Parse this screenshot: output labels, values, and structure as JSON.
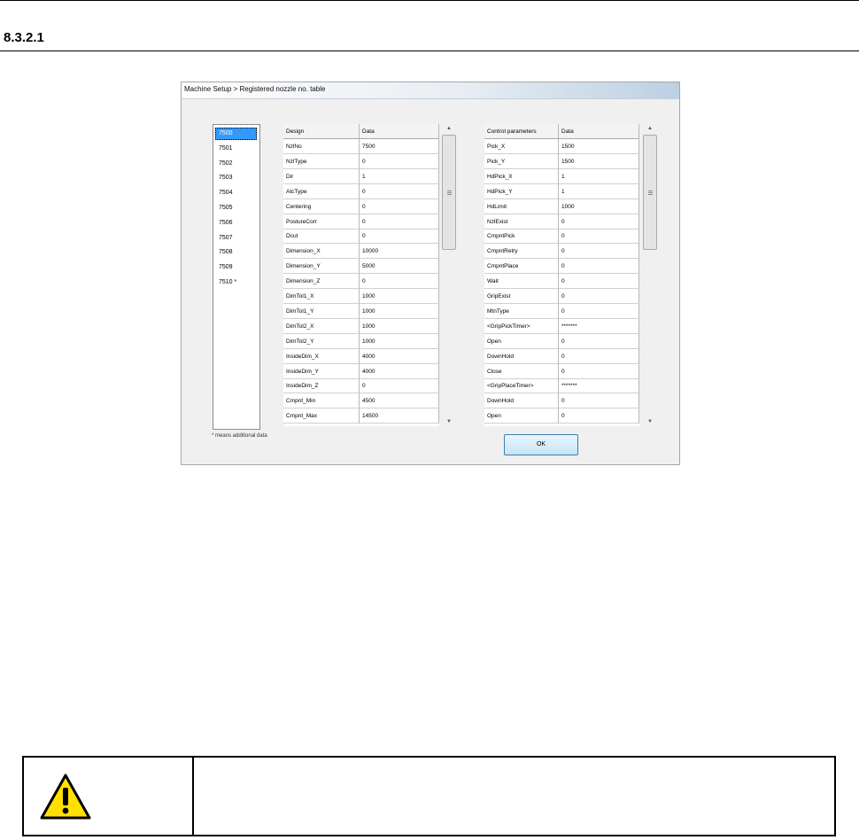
{
  "section": {
    "number": "8.3.2.1"
  },
  "window": {
    "title": "Machine Setup > Registered nozzle no. table"
  },
  "nozzle_list": {
    "items": [
      "7500",
      "7501",
      "7502",
      "7503",
      "7504",
      "7505",
      "7506",
      "7507",
      "7508",
      "7509",
      "7510 *"
    ],
    "selected": "7500"
  },
  "footnote": "* means additional data",
  "design_table": {
    "headers": [
      "Design",
      "Data"
    ],
    "rows": [
      [
        "NzlNo",
        "7500"
      ],
      [
        "NzlType",
        "0"
      ],
      [
        "Dir",
        "1"
      ],
      [
        "AtcType",
        "0"
      ],
      [
        "Centering",
        "0"
      ],
      [
        "PostureCorr",
        "0"
      ],
      [
        "Dcut",
        "0"
      ],
      [
        "Dimension_X",
        "10000"
      ],
      [
        "Dimension_Y",
        "5000"
      ],
      [
        "Dimension_Z",
        "0"
      ],
      [
        "DimTol1_X",
        "1000"
      ],
      [
        "DimTol1_Y",
        "1000"
      ],
      [
        "DimTol2_X",
        "1000"
      ],
      [
        "DimTol2_Y",
        "1000"
      ],
      [
        "InsideDim_X",
        "4000"
      ],
      [
        "InsideDim_Y",
        "4000"
      ],
      [
        "InsideDim_Z",
        "0"
      ],
      [
        "Cmpnt_Min",
        "4500"
      ],
      [
        "Cmpnt_Max",
        "14500"
      ]
    ]
  },
  "control_table": {
    "headers": [
      "Control parameters",
      "Data"
    ],
    "rows": [
      [
        "Pick_X",
        "1500"
      ],
      [
        "Pick_Y",
        "1500"
      ],
      [
        "HdPick_X",
        "1"
      ],
      [
        "HdPick_Y",
        "1"
      ],
      [
        "HdLimit",
        "1000"
      ],
      [
        "NzlExist",
        "0"
      ],
      [
        "CmpntPick",
        "0"
      ],
      [
        "CmpntRetry",
        "0"
      ],
      [
        "CmpntPlace",
        "0"
      ],
      [
        "Wait",
        "0"
      ],
      [
        "GripExist",
        "0"
      ],
      [
        "MtnType",
        "0"
      ],
      [
        "<GripPickTimer>",
        "*******"
      ],
      [
        "Open",
        "0"
      ],
      [
        "DownHold",
        "0"
      ],
      [
        "Close",
        "0"
      ],
      [
        "<GripPlaceTimer>",
        "*******"
      ],
      [
        "DownHold",
        "0"
      ],
      [
        "Open",
        "0"
      ]
    ]
  },
  "buttons": {
    "ok": "OK"
  },
  "scroll_icons": {
    "up": "▲",
    "down": "▼"
  },
  "colors": {
    "selection": "#3399ff",
    "caution_fill": "#ffe000"
  }
}
